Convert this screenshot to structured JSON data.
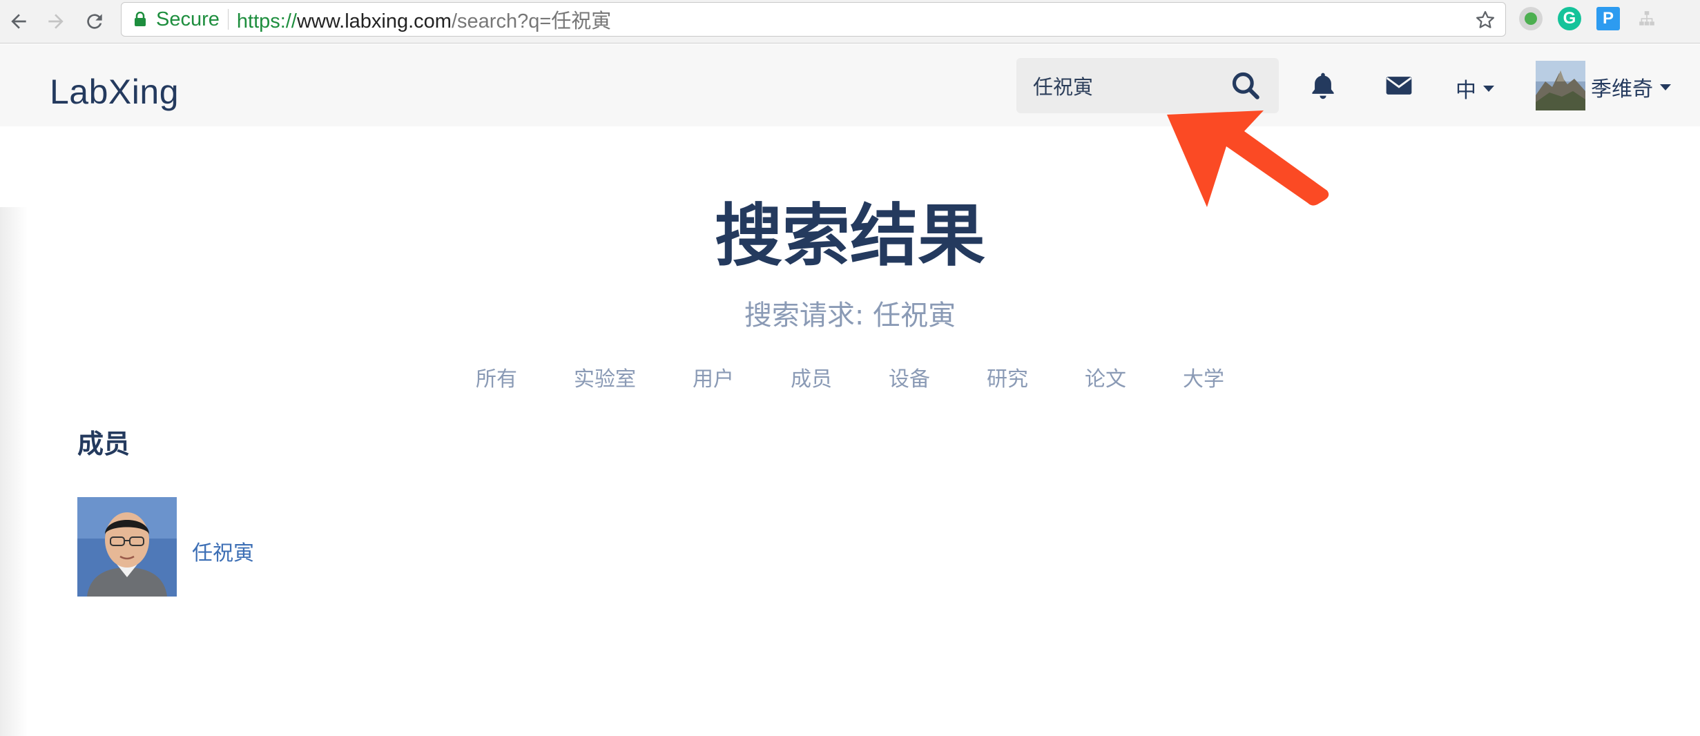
{
  "browser": {
    "secure_label": "Secure",
    "url_scheme": "https://",
    "url_host": "www.labxing.com",
    "url_path": "/search?q=任祝寅",
    "extensions": [
      {
        "name": "green-dot-extension-icon",
        "glyph": "",
        "color": "#8a8a8a"
      },
      {
        "name": "grammarly-icon",
        "glyph": "G",
        "color": "#15c39a"
      },
      {
        "name": "p-extension-icon",
        "glyph": "P",
        "color": "#2d9bf0"
      },
      {
        "name": "sitemap-extension-icon",
        "glyph": "",
        "color": "#cccccc"
      }
    ]
  },
  "header": {
    "logo": "LabXing",
    "search_value": "任祝寅",
    "language": "中",
    "username": "季维奇"
  },
  "main": {
    "title": "搜索结果",
    "query_line": "搜索请求: 任祝寅",
    "filters": [
      "所有",
      "实验室",
      "用户",
      "成员",
      "设备",
      "研究",
      "论文",
      "大学"
    ],
    "section_title": "成员",
    "members": [
      {
        "name": "任祝寅"
      }
    ]
  },
  "colors": {
    "brand": "#243a5e",
    "muted": "#8a9ab5",
    "link": "#3d6fb5",
    "annotation_arrow": "#fb4a24"
  }
}
